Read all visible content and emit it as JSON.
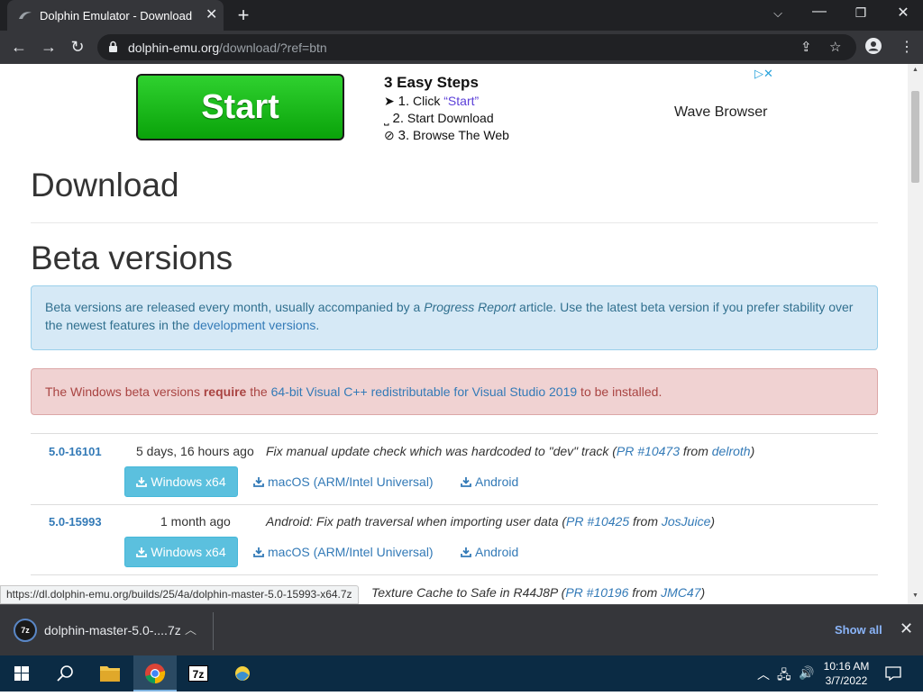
{
  "browser": {
    "tab_title": "Dolphin Emulator - Download",
    "tab_close": "✕",
    "new_tab": "+",
    "url_host": "dolphin-emu.org",
    "url_path": "/download/?ref=btn"
  },
  "ad": {
    "start_label": "Start",
    "steps_title": "3 Easy Steps",
    "step1_num": "1.",
    "step1_pre": "Click ",
    "step1_quote": "“Start”",
    "step2_num": "2.",
    "step2": "Start Download",
    "step3_num": "3.",
    "step3": "Browse The Web",
    "brand": "Wave Browser",
    "adchoice": "▷✕"
  },
  "page": {
    "title": "Download",
    "section": "Beta versions",
    "info_pre": "Beta versions are released every month, usually accompanied by a ",
    "info_em": "Progress Report",
    "info_mid": " article. Use the latest beta version if you prefer stability over the newest features in the ",
    "info_link": "development versions",
    "info_post": ".",
    "warn_pre": "The Windows beta versions ",
    "warn_strong": "require",
    "warn_mid": " the ",
    "warn_link": "64-bit Visual C++ redistributable for Visual Studio 2019",
    "warn_post": " to be installed."
  },
  "builds": [
    {
      "version": "5.0-16101",
      "date": "5 days, 16 hours ago",
      "desc": "Fix manual update check which was hardcoded to \"dev\" track (",
      "pr": "PR #10473",
      "from": " from ",
      "author": "delroth",
      "end": ")",
      "win": "Windows x64",
      "mac": "macOS (ARM/Intel Universal)",
      "android": "Android"
    },
    {
      "version": "5.0-15993",
      "date": "1 month ago",
      "desc": "Android: Fix path traversal when importing user data (",
      "pr": "PR #10425",
      "from": " from ",
      "author": "JosJuice",
      "end": ")",
      "win": "Windows x64",
      "mac": "macOS (ARM/Intel Universal)",
      "android": "Android"
    },
    {
      "desc": "Texture Cache to Safe in R44J8P (",
      "pr": "PR #10196",
      "from": " from ",
      "author": "JMC47",
      "end": ")"
    }
  ],
  "status_url": "https://dl.dolphin-emu.org/builds/25/4a/dolphin-master-5.0-15993-x64.7z",
  "shelf": {
    "file_icon": "7z",
    "filename": "dolphin-master-5.0-....7z",
    "show_all": "Show all"
  },
  "taskbar": {
    "app_7z": "7z",
    "time": "10:16 AM",
    "date": "3/7/2022"
  },
  "colors": {
    "link": "#337ab7",
    "info_bg": "#d6e9f6",
    "danger_bg": "#f0d2d2",
    "btn_win": "#5bc0de",
    "chrome_dark": "#202124",
    "taskbar": "#0b2b44"
  }
}
